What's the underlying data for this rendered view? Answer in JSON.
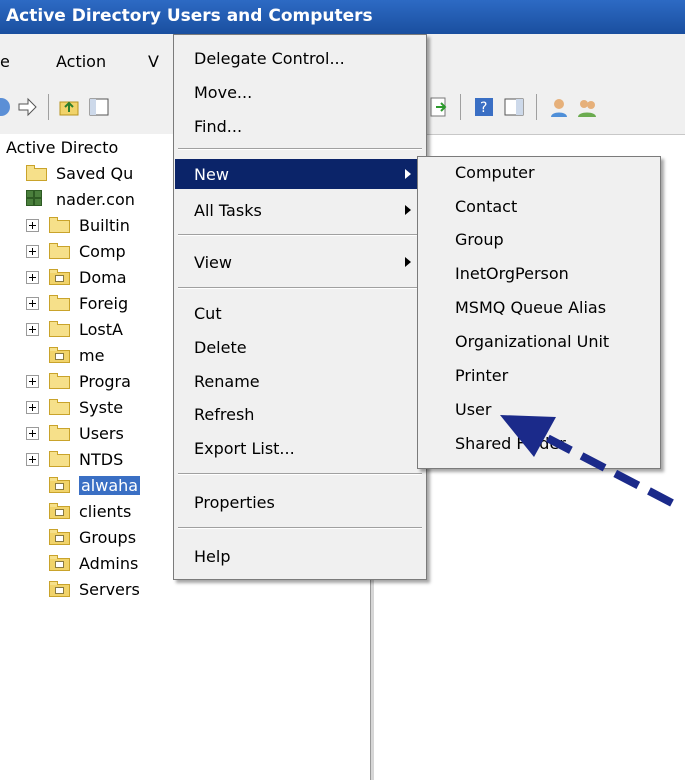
{
  "window": {
    "title": "Active Directory Users and Computers"
  },
  "menubar": {
    "items": [
      "e",
      "Action",
      "V"
    ]
  },
  "tree": {
    "root": "Active Directo",
    "saved": "Saved Qu",
    "domain": "nader.con",
    "items": [
      {
        "label": "Builtin",
        "expand": true,
        "ou": false
      },
      {
        "label": "Comp",
        "expand": true,
        "ou": false
      },
      {
        "label": "Doma",
        "expand": true,
        "ou": true
      },
      {
        "label": "Foreig",
        "expand": true,
        "ou": false
      },
      {
        "label": "LostA",
        "expand": true,
        "ou": false
      },
      {
        "label": "me",
        "expand": false,
        "ou": true
      },
      {
        "label": "Progra",
        "expand": true,
        "ou": false
      },
      {
        "label": "Syste",
        "expand": true,
        "ou": false
      },
      {
        "label": "Users",
        "expand": true,
        "ou": false
      },
      {
        "label": "NTDS",
        "expand": true,
        "ou": false
      },
      {
        "label": "alwaha",
        "expand": false,
        "ou": true,
        "selected": true
      },
      {
        "label": "clients",
        "expand": false,
        "ou": true
      },
      {
        "label": "Groups",
        "expand": false,
        "ou": true
      },
      {
        "label": "Admins",
        "expand": false,
        "ou": true
      },
      {
        "label": "Servers",
        "expand": false,
        "ou": true
      }
    ]
  },
  "context_menu": {
    "delegate": "Delegate Control...",
    "move": "Move...",
    "find": "Find...",
    "new": "New",
    "all_tasks": "All Tasks",
    "view": "View",
    "cut": "Cut",
    "delete": "Delete",
    "rename": "Rename",
    "refresh": "Refresh",
    "export": "Export List...",
    "properties": "Properties",
    "help": "Help"
  },
  "submenu": {
    "items": [
      "Computer",
      "Contact",
      "Group",
      "InetOrgPerson",
      "MSMQ Queue Alias",
      "Organizational Unit",
      "Printer",
      "User",
      "Shared Folder"
    ]
  },
  "colors": {
    "highlight": "#0b2469",
    "arrow": "#1b2a8a",
    "titlebar": "#1f58ad"
  }
}
